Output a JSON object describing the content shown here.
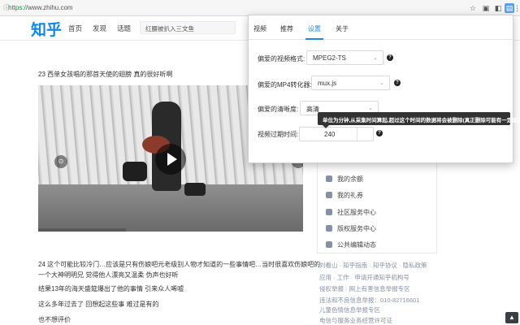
{
  "browser": {
    "url_protocol": "https://",
    "url_host": "www.zhihu.com",
    "icons": [
      "star-icon",
      "screenshot-icon",
      "extension-icon",
      "video-download-extension-icon",
      "menu-icon"
    ]
  },
  "site": {
    "logo": "知乎",
    "nav": [
      "首页",
      "发现",
      "话题"
    ],
    "search_value": "红腰被扒入三文鱼"
  },
  "feed": {
    "item1_title": "23 西单女孩唱的那首天使的翅膀 真的很好听啊",
    "video_progress": 0.33,
    "line1": "24 这个可能比较冷门…应该是只有伤娘吧元老级别人物才知道的一些事情吧…当时很喜欢伤娘吧的",
    "line2": "一个大神明明兄 觉得他人漂亮又温柔 伪声也好听",
    "line3": "结果13年的海天盛筵爆出了他的事情 引来众人唏嘘",
    "line4": "这么多年过去了 回想起这些事 难过是有的",
    "line5": "也不想评价"
  },
  "sidebar": {
    "items": [
      "我的余额",
      "我的礼券",
      "社区服务中心",
      "版权服务中心",
      "公共编辑动态"
    ],
    "footer": [
      "刘看山 · 知乎指南 · 知乎协议 · 隐私政策",
      "应用 · 工作 · 申请开通知乎机构号",
      "侵权举报 · 网上有害信息举报专区",
      "违法和不良信息举报：010-82716601",
      "儿童色情信息举报专区",
      "电信与服务业务经营许可证"
    ]
  },
  "popup": {
    "tabs": [
      "视频",
      "推荐",
      "设置",
      "关于"
    ],
    "active_tab": "设置",
    "format_label": "偏爱的视频格式:",
    "format_value": "MPEG2-TS",
    "mp4_label": "偏爱的MP4转化器:",
    "mp4_value": "mux.js",
    "quality_label": "偏爱的清晰度:",
    "quality_value": "高清",
    "expire_label": "视频过期时间:",
    "expire_value": "240",
    "tooltip": "单位为分钟,从采集时间算起,超过这个时间的数据将会被删除(真正删除可能有一定延迟)",
    "accent_color": "#1e88e5"
  }
}
